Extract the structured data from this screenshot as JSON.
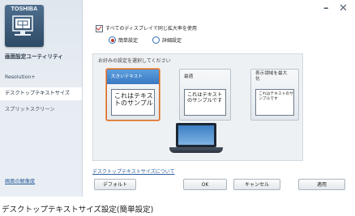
{
  "window": {
    "brand": "TOSHIBA",
    "app_title": "画面設定ユーティリティ",
    "minimize_glyph": "–",
    "close_glyph": "✕"
  },
  "sidebar": {
    "items": [
      {
        "label": "Resolution+"
      },
      {
        "label": "デスクトップテキストサイズ"
      },
      {
        "label": "スプリットスクリーン"
      }
    ],
    "bottom_link": "画面の解像度"
  },
  "settings": {
    "all_displays_label": "すべてのディスプレイで同じ拡大率を使用",
    "all_displays_checked": true,
    "mode_simple_label": "簡単設定",
    "mode_detail_label": "詳細設定",
    "selected_mode": "簡単設定"
  },
  "panel": {
    "title": "お好みの設定を選択してください",
    "options": [
      {
        "title": "大きいテキスト",
        "sample": "これはテキス\nトのサンプル",
        "selected": true
      },
      {
        "title": "最適",
        "sample": "これはテキスト\nのサンプルです",
        "selected": false
      },
      {
        "title": "表示領域を最大\n化",
        "sample": "これはテキストのサ\nンプルです",
        "selected": false
      }
    ]
  },
  "about_link": "デスクトップテキストサイズについて",
  "buttons": {
    "default": "デフォルト",
    "ok": "OK",
    "cancel": "キャンセル",
    "apply": "適用"
  },
  "caption": "デスクトップテキストサイズ設定(簡単設定)",
  "colors": {
    "accent_blue": "#3a78c2",
    "selection_orange": "#d06a2e",
    "radio_red": "#c0392b"
  },
  "icons": {
    "app_logo": "monitor-icon",
    "laptop": "laptop-icon"
  }
}
